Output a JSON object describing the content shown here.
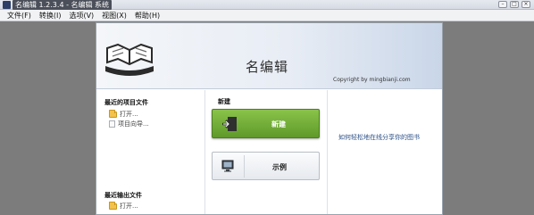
{
  "window": {
    "title": "名编辑 1.2.3.4 - 名编辑 系统"
  },
  "menu": {
    "items": [
      "文件(F)",
      "转换(I)",
      "选项(V)",
      "视图(X)",
      "帮助(H)"
    ]
  },
  "header": {
    "title": "名编辑",
    "copyright": "Copyright by mingbianji.com"
  },
  "recent_projects": {
    "heading": "最近的项目文件",
    "open_label": "打开...",
    "wizard_label": "项目向导..."
  },
  "recent_outputs": {
    "heading": "最近输出文件",
    "open_label": "打开..."
  },
  "create": {
    "heading": "新建",
    "new_button_label": "新建",
    "example_button_label": "示例"
  },
  "help": {
    "link_text": "如何轻松地在线分享你的图书"
  },
  "colors": {
    "accent_green": "#6fae36",
    "header_blue": "#c9d6e8",
    "workspace_gray": "#7c7c7c"
  },
  "icons": {
    "app": "app-icon",
    "logo": "book-logo-icon",
    "folder": "folder-icon",
    "document": "document-icon",
    "new": "enter-arrow-icon",
    "example": "monitor-icon"
  }
}
